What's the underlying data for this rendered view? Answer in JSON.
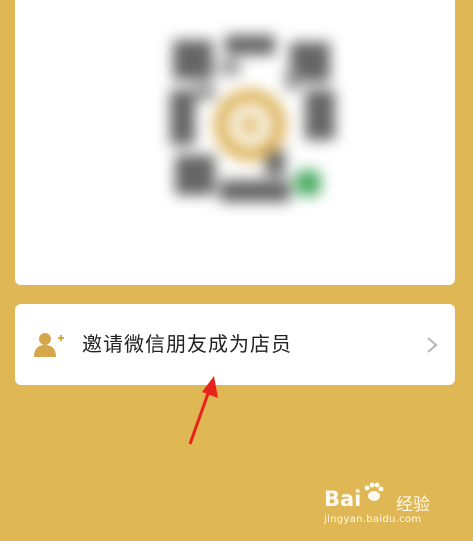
{
  "invite": {
    "label": "邀请微信朋友成为店员",
    "icon": "add-user-icon",
    "chevron": "chevron-right-icon"
  },
  "qr_card": {
    "content": "blurred-qr-code"
  },
  "colors": {
    "background": "#dfb755",
    "card": "#ffffff",
    "accent_icon": "#d4a74a",
    "annotation_arrow": "#e8231b"
  },
  "watermark": {
    "logo": "Bai  ",
    "name": "经验",
    "url": "jingyan.baidu.com"
  }
}
